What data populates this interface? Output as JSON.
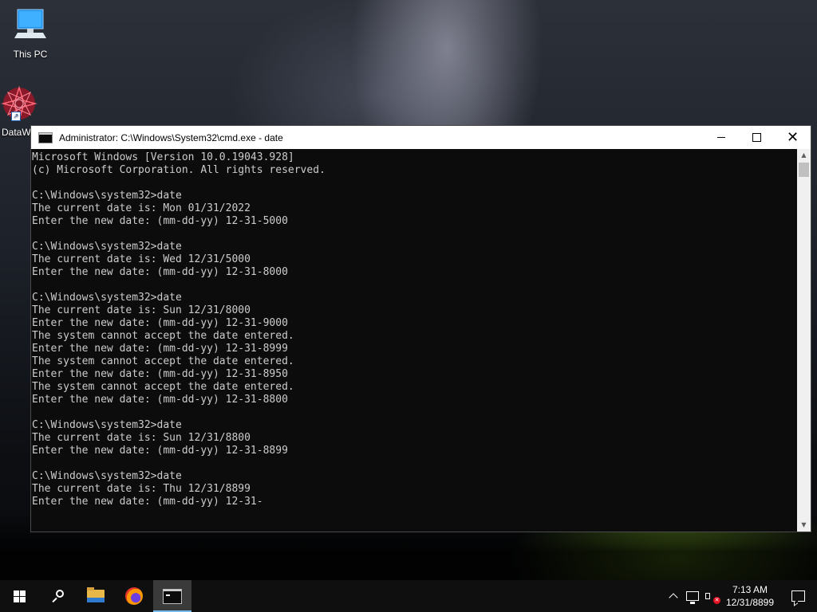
{
  "desktop": {
    "icons": [
      {
        "label": "This PC",
        "icon": "this-pc-icon"
      },
      {
        "label": "DataW",
        "icon": "datawrapper-icon"
      }
    ]
  },
  "window": {
    "title": "Administrator: C:\\Windows\\System32\\cmd.exe - date",
    "controls": {
      "minimize": "minimize",
      "maximize": "maximize",
      "close": "close"
    }
  },
  "console": {
    "lines": [
      "Microsoft Windows [Version 10.0.19043.928]",
      "(c) Microsoft Corporation. All rights reserved.",
      "",
      "C:\\Windows\\system32>date",
      "The current date is: Mon 01/31/2022",
      "Enter the new date: (mm-dd-yy) 12-31-5000",
      "",
      "C:\\Windows\\system32>date",
      "The current date is: Wed 12/31/5000",
      "Enter the new date: (mm-dd-yy) 12-31-8000",
      "",
      "C:\\Windows\\system32>date",
      "The current date is: Sun 12/31/8000",
      "Enter the new date: (mm-dd-yy) 12-31-9000",
      "The system cannot accept the date entered.",
      "Enter the new date: (mm-dd-yy) 12-31-8999",
      "The system cannot accept the date entered.",
      "Enter the new date: (mm-dd-yy) 12-31-8950",
      "The system cannot accept the date entered.",
      "Enter the new date: (mm-dd-yy) 12-31-8800",
      "",
      "C:\\Windows\\system32>date",
      "The current date is: Sun 12/31/8800",
      "Enter the new date: (mm-dd-yy) 12-31-8899",
      "",
      "C:\\Windows\\system32>date",
      "The current date is: Thu 12/31/8899",
      "Enter the new date: (mm-dd-yy) 12-31-"
    ]
  },
  "taskbar": {
    "apps": [
      {
        "name": "start",
        "icon": "windows-logo-icon"
      },
      {
        "name": "search",
        "icon": "search-icon"
      },
      {
        "name": "file-explorer",
        "icon": "folder-icon"
      },
      {
        "name": "firefox",
        "icon": "firefox-icon"
      },
      {
        "name": "command-prompt",
        "icon": "cmd-icon",
        "active": true
      }
    ],
    "tray": {
      "time": "7:13 AM",
      "date": "12/31/8899",
      "icons": [
        "chevron-up-icon",
        "network-icon",
        "volume-muted-icon",
        "notification-icon"
      ]
    }
  },
  "colors": {
    "console_bg": "#0c0c0c",
    "console_fg": "#cccccc",
    "taskbar_bg": "#0f0f0f",
    "active_indicator": "#76b9ed"
  }
}
